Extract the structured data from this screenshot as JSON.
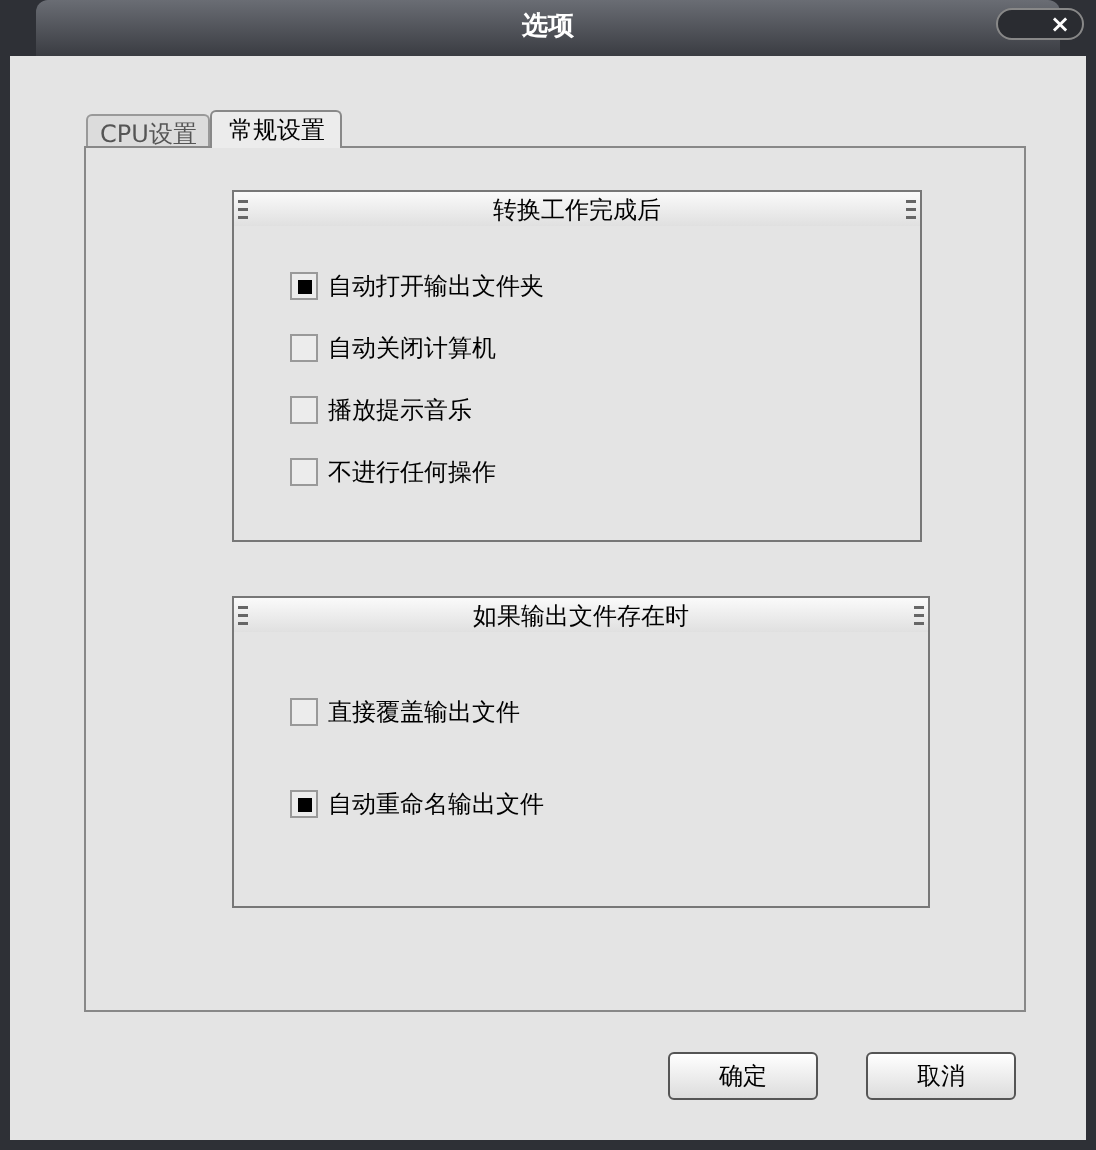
{
  "window": {
    "title": "选项",
    "close": "×"
  },
  "tabs": [
    {
      "label": "CPU设置",
      "selected": false
    },
    {
      "label": "常规设置",
      "selected": true
    }
  ],
  "groups": [
    {
      "title": "转换工作完成后",
      "options": [
        {
          "label": "自动打开输出文件夹",
          "checked": true
        },
        {
          "label": "自动关闭计算机",
          "checked": false
        },
        {
          "label": "播放提示音乐",
          "checked": false
        },
        {
          "label": "不进行任何操作",
          "checked": false
        }
      ]
    },
    {
      "title": "如果输出文件存在时",
      "options": [
        {
          "label": "直接覆盖输出文件",
          "checked": false
        },
        {
          "label": "自动重命名输出文件",
          "checked": true
        }
      ]
    }
  ],
  "buttons": [
    "确定",
    "取消"
  ]
}
